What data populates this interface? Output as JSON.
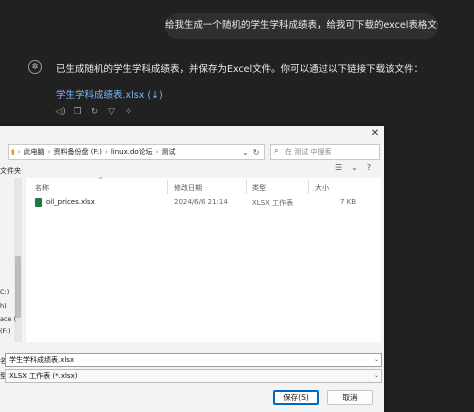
{
  "chat": {
    "user_message": "给我生成一个随机的学生学科成绩表，给我可下载的excel表格文件",
    "assistant_message": "已生成随机的学生学科成绩表，并保存为Excel文件。你可以通过以下链接下载该文件：",
    "download_link": "学生学科成绩表.xlsx (↓)",
    "actions": [
      "copy-icon",
      "read-aloud-icon",
      "regenerate-icon",
      "thumbs-down-icon",
      "model-icon"
    ]
  },
  "dialog": {
    "close_glyph": "✕",
    "address": {
      "items": [
        "此电脑",
        "资料备份盘 (F:)",
        "linux.do论坛",
        "测试"
      ],
      "separator": "›"
    },
    "search_placeholder": "在 测试 中搜索",
    "toolbar_left": "文件夹",
    "nav_items": [
      "C:)",
      "h)",
      "ace (",
      "(F:)"
    ],
    "columns": {
      "name": "名称",
      "modified": "修改日期",
      "type": "类型",
      "size": "大小"
    },
    "files": [
      {
        "name": "oil_prices.xlsx",
        "modified": "2024/6/6 21:14",
        "type": "XLSX 工作表",
        "size": "7 KB"
      }
    ],
    "filename_label": "名:",
    "filename_value": "学生学科成绩表.xlsx",
    "filetype_label": "型:",
    "filetype_value": "XLSX 工作表 (*.xlsx)",
    "save_label": "保存(S)",
    "cancel_label": "取消",
    "colors": {
      "primary_border": "#0067c0",
      "link": "#7ab7ff"
    }
  }
}
